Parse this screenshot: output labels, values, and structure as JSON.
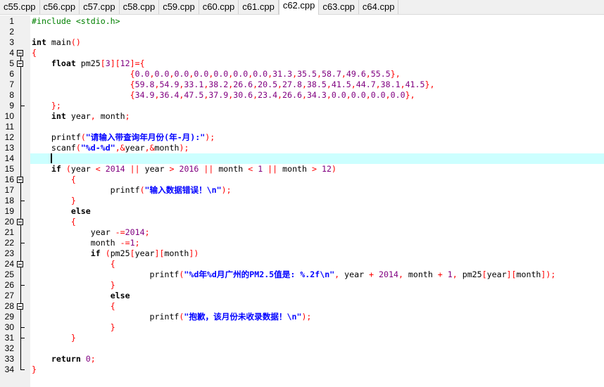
{
  "tabs": [
    {
      "label": "c55.cpp"
    },
    {
      "label": "c56.cpp"
    },
    {
      "label": "c57.cpp"
    },
    {
      "label": "c58.cpp"
    },
    {
      "label": "c59.cpp"
    },
    {
      "label": "c60.cpp"
    },
    {
      "label": "c61.cpp"
    },
    {
      "label": "c62.cpp",
      "active": true
    },
    {
      "label": "c63.cpp"
    },
    {
      "label": "c64.cpp"
    }
  ],
  "editor": {
    "current_line": 14,
    "fold_markers": [
      4,
      5,
      16,
      20,
      24,
      28
    ],
    "fold_ends": [
      9,
      18,
      22,
      26,
      30,
      31,
      34
    ],
    "lines": [
      "#include <stdio.h>",
      "",
      "int main()",
      "{",
      "    float pm25[3][12]={",
      "                    {0.0,0.0,0.0,0.0,0.0,0.0,0.0,31.3,35.5,58.7,49.6,55.5},",
      "                    {59.8,54.9,33.1,38.2,26.6,20.5,27.8,38.5,41.5,44.7,38.1,41.5},",
      "                    {34.9,36.4,47.5,37.9,30.6,23.4,26.6,34.3,0.0,0.0,0.0,0.0},",
      "    };",
      "    int year, month;",
      "",
      "    printf(\"请输入带查询年月份(年-月):\");",
      "    scanf(\"%d-%d\",&year,&month);",
      "    ",
      "    if (year < 2014 || year > 2016 || month < 1 || month > 12)",
      "        {",
      "                printf(\"输入数据错误！\\n\");",
      "        }",
      "        else",
      "        {",
      "            year -=2014;",
      "            month -=1;",
      "            if (pm25[year][month])",
      "                {",
      "                        printf(\"%d年%d月广州的PM2.5值是: %.2f\\n\", year + 2014, month + 1, pm25[year][month]);",
      "                }",
      "                else",
      "                {",
      "                        printf(\"抱歉，该月份未收录数据！\\n\");",
      "                }",
      "        }",
      "",
      "    return 0;",
      "}"
    ]
  }
}
